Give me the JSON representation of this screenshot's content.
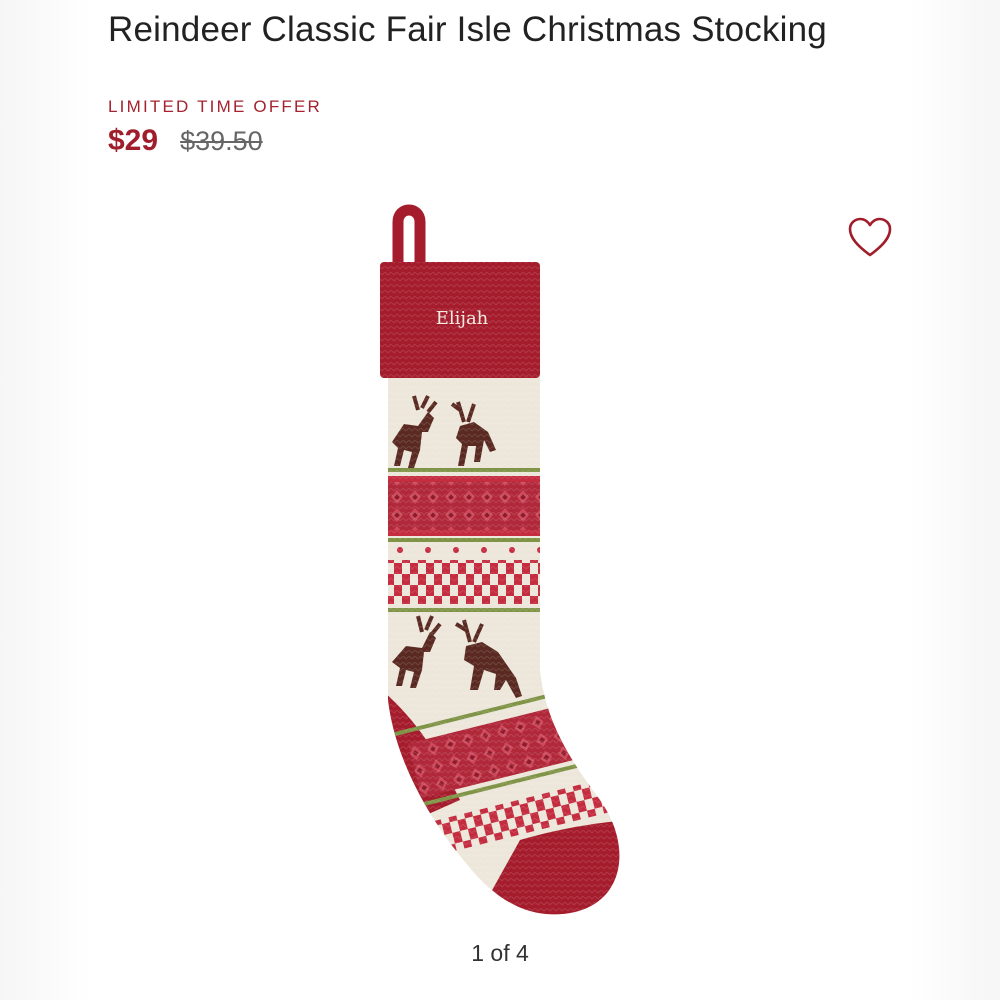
{
  "product": {
    "title": "Reindeer Classic Fair Isle Christmas Stocking",
    "offer_label": "LIMITED TIME OFFER",
    "price_current": "$29",
    "price_original": "$39.50",
    "personalization": "Elijah"
  },
  "gallery": {
    "pager": "1 of 4"
  },
  "icons": {
    "favorite": "heart-outline-icon"
  },
  "colors": {
    "accent": "#a01e2b",
    "stocking_red": "#a51d2d",
    "cream": "#ede6da",
    "reindeer_brown": "#5a2a22",
    "stripe_green": "#7f9446"
  }
}
